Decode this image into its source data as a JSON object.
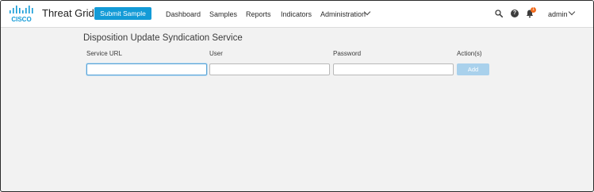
{
  "header": {
    "brand_logo": "cisco-logo",
    "product_name": "Threat Grid",
    "submit_button": "Submit Sample",
    "nav": [
      {
        "label": "Dashboard"
      },
      {
        "label": "Samples"
      },
      {
        "label": "Reports"
      },
      {
        "label": "Indicators"
      },
      {
        "label": "Administration",
        "has_dropdown": true
      }
    ],
    "icons": [
      "search-icon",
      "help-icon",
      "bell-icon"
    ],
    "notification_count": "1",
    "user_name": "admin"
  },
  "main": {
    "title": "Disposition Update Syndication Service",
    "columns": [
      "Service URL",
      "User",
      "Password",
      "Action(s)"
    ],
    "form": {
      "service_url": {
        "value": "",
        "placeholder": "",
        "focused": true
      },
      "user": {
        "value": "",
        "placeholder": ""
      },
      "password": {
        "value": "",
        "placeholder": ""
      },
      "add_label": "Add",
      "add_disabled": true
    }
  },
  "colors": {
    "accent": "#139bd7",
    "notification_badge": "#f26b1d",
    "page_background": "#f2f2f2",
    "disabled_button": "#a9d1ec"
  }
}
